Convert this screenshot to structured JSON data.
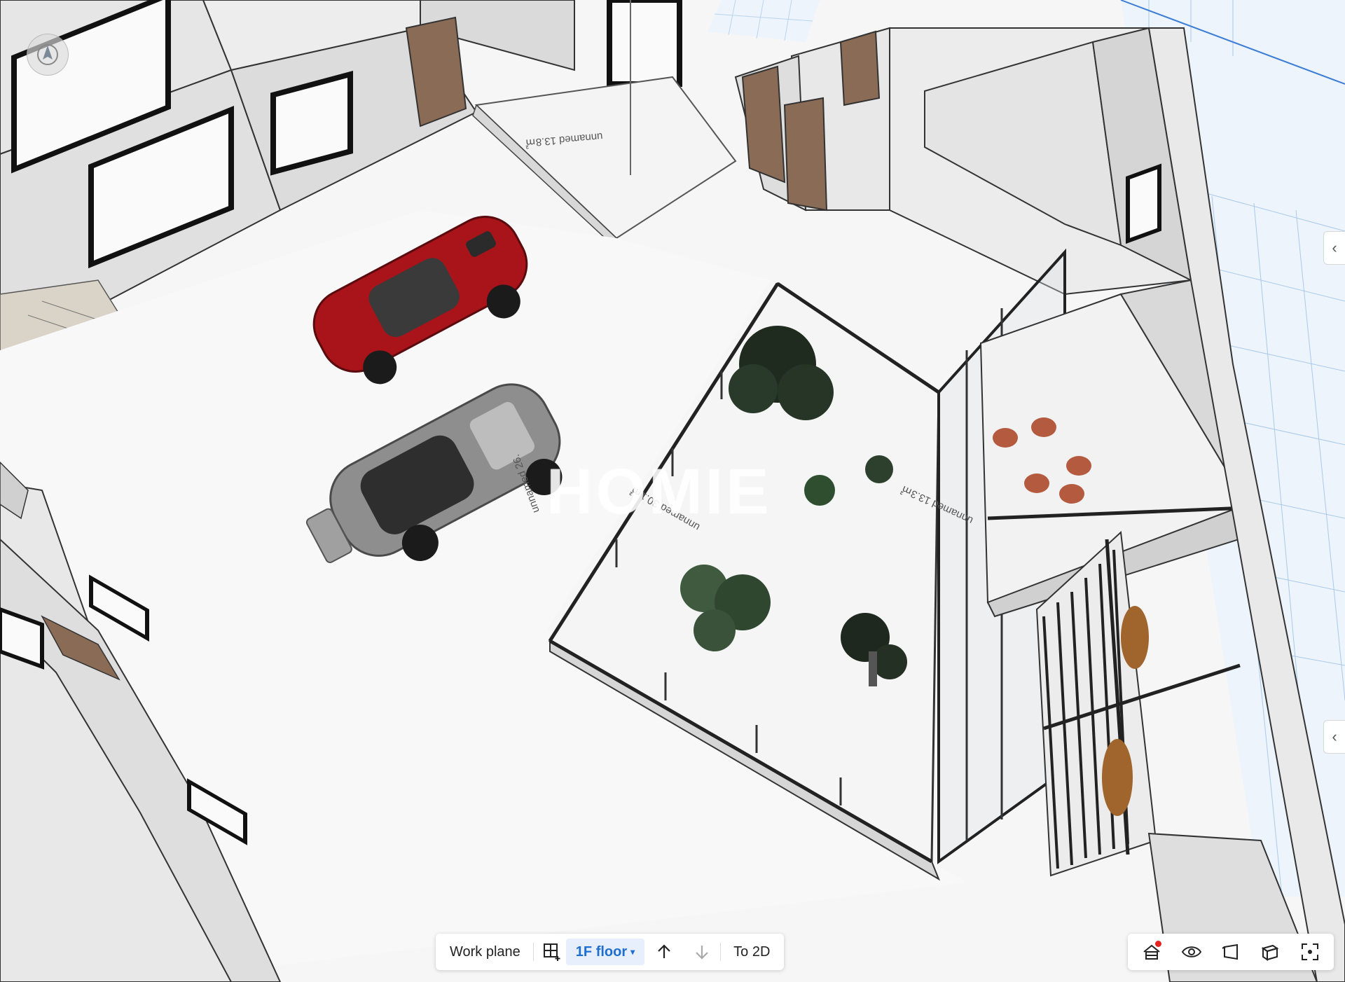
{
  "scene": {
    "labels": {
      "room_top": "unnamed 13.8㎡",
      "room_garden": "unnamed 30.1㎡",
      "room_garage": "unnamed 26.",
      "room_right": "unnamed 13.3㎡"
    },
    "watermark": "HOMIE"
  },
  "toolbar": {
    "work_plane": "Work plane",
    "add_grid_icon": "grid-add-icon",
    "floor_label": "1F floor",
    "floor_caret": "▾",
    "up_icon": "arrow-up-icon",
    "down_icon": "arrow-down-icon",
    "to_2d": "To 2D"
  },
  "viewtools": {
    "icons": [
      "roof-icon",
      "eye-icon",
      "plane-icon",
      "cube-icon",
      "fullscreen-icon"
    ],
    "notification_color": "#e5241f"
  },
  "colors": {
    "accent": "#1f6fd1",
    "accent_bg": "#e6effb",
    "floor": "#f7f7f7",
    "wall": "#e2e2e2",
    "car_red": "#a8141a",
    "car_grey": "#8e8e8e"
  }
}
